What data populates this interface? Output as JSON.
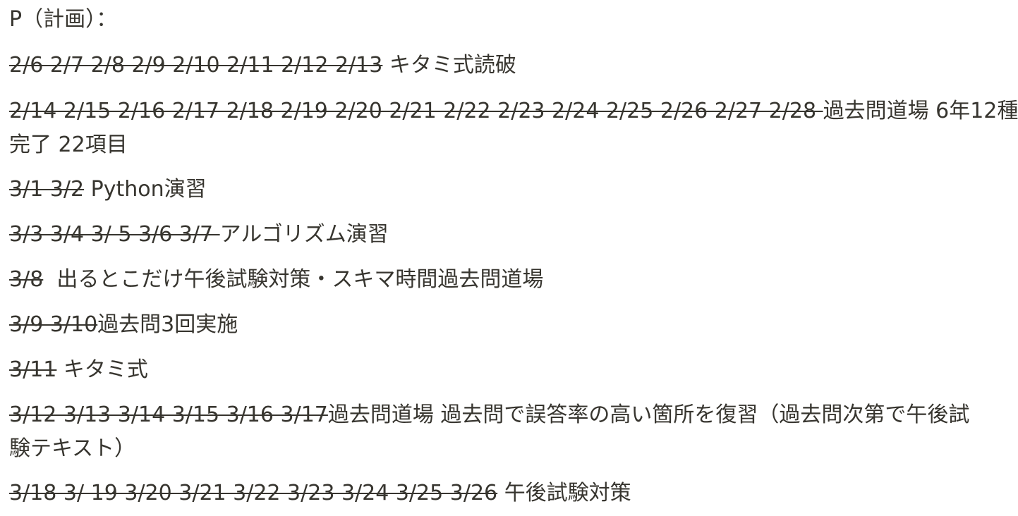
{
  "title": "P（計画）：",
  "entries": [
    {
      "dates": "2/6 2/7 2/8 2/9 2/10 2/11 2/12 2/13",
      "sep": " ",
      "task": "キタミ式読破"
    },
    {
      "dates": "2/14 2/15 2/16 2/17 2/18 2/19 2/20 2/21 2/22 2/23 2/24 2/25 2/26 2/27 2/28 ",
      "sep": "",
      "task": "過去問道場 6年12種",
      "task_line2": "完了 22項目"
    },
    {
      "dates": "3/1 3/2",
      "sep": " ",
      "task": "Python演習"
    },
    {
      "dates": "3/3 3/4 3/ 5 3/6 3/7 ",
      "sep": "",
      "task": "アルゴリズム演習"
    },
    {
      "dates": "3/8",
      "sep": "  ",
      "task": "出るとこだけ午後試験対策・スキマ時間過去問道場"
    },
    {
      "dates": "3/9 3/10",
      "sep": "",
      "task": "過去問3回実施"
    },
    {
      "dates": "3/11",
      "sep": " ",
      "task": "キタミ式"
    },
    {
      "dates": "3/12 3/13 3/14 3/15 3/16 3/17",
      "sep": "",
      "task": "過去問道場 過去問で誤答率の高い箇所を復習（過去問次第で午後試",
      "task_line2": "験テキスト）"
    },
    {
      "dates": "3/18 3/ 19 3/20 3/21 3/22 3/23 3/24 3/25 3/26",
      "sep": " ",
      "task": "午後試験対策"
    }
  ]
}
